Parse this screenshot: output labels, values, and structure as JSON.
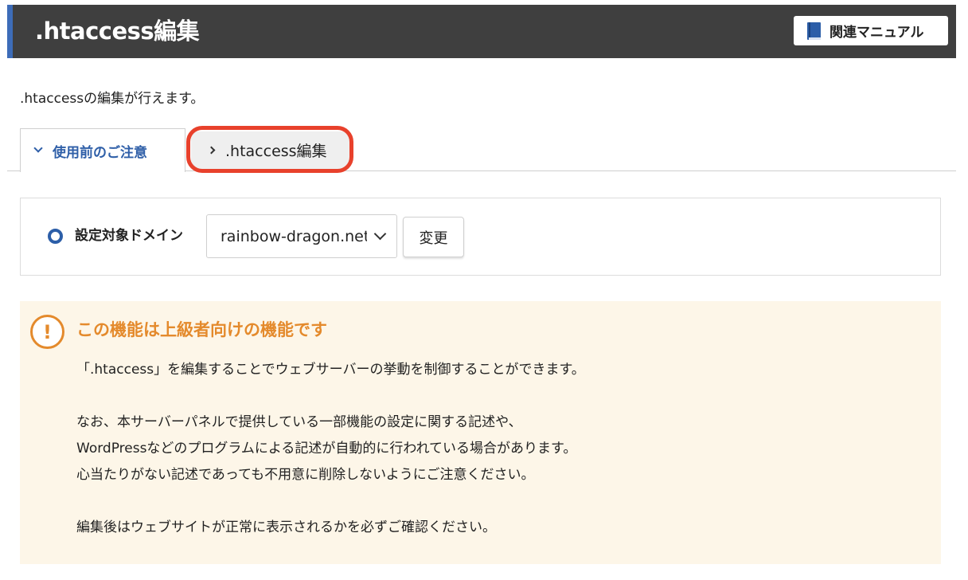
{
  "header": {
    "title": ".htaccess編集",
    "manual_button": "関連マニュアル",
    "manual_icon": "book-icon"
  },
  "intro_text": ".htaccessの編集が行えます。",
  "tabs": [
    {
      "label": "使用前のご注意",
      "active": true
    },
    {
      "label": ".htaccess編集",
      "active": false
    }
  ],
  "domain": {
    "label": "設定対象ドメイン",
    "selected_value": "rainbow-dragon.net",
    "change_button": "変更"
  },
  "warning": {
    "icon": "exclamation",
    "title": "この機能は上級者向けの機能です",
    "line1": "「.htaccess」を編集することでウェブサーバーの挙動を制御することができます。",
    "line2": "なお、本サーバーパネルで提供している一部機能の設定に関する記述や、",
    "line3": "WordPressなどのプログラムによる記述が自動的に行われている場合があります。",
    "line4": "心当たりがない記述であっても不用意に削除しないようにご注意ください。",
    "line5": "編集後はウェブサイトが正常に表示されるかを必ずご確認ください。"
  },
  "colors": {
    "header_bg": "#3f3f3f",
    "header_accent": "#3d6cb8",
    "tab_active_text": "#2f5fa8",
    "highlight_ring": "#e8412c",
    "warning_bg": "#fdf6e8",
    "warning_accent": "#e48a2c"
  }
}
